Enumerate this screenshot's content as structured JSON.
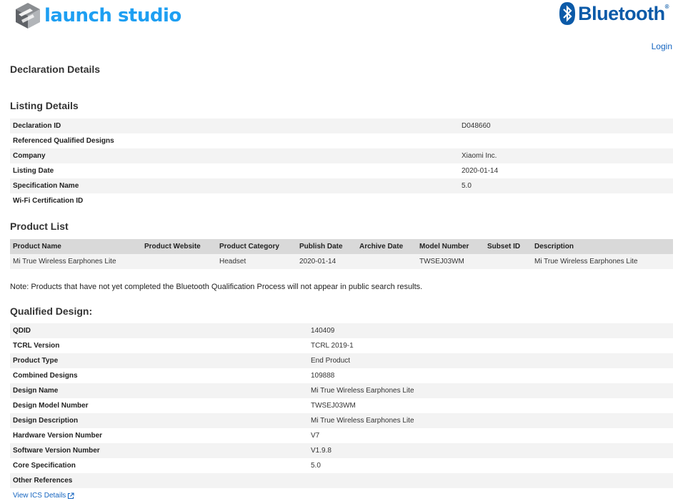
{
  "header": {
    "launch_text": "launch studio",
    "bluetooth_text": "Bluetooth",
    "bluetooth_reg": "®",
    "login": "Login"
  },
  "page_title": "Declaration Details",
  "listing": {
    "title": "Listing Details",
    "rows": [
      {
        "key": "Declaration ID",
        "value": "D048660"
      },
      {
        "key": "Referenced Qualified Designs",
        "value": ""
      },
      {
        "key": "Company",
        "value": "Xiaomi Inc."
      },
      {
        "key": "Listing Date",
        "value": "2020-01-14"
      },
      {
        "key": "Specification Name",
        "value": "5.0"
      },
      {
        "key": "Wi-Fi Certification ID",
        "value": ""
      }
    ]
  },
  "products": {
    "title": "Product List",
    "headers": [
      "Product Name",
      "Product Website",
      "Product Category",
      "Publish Date",
      "Archive Date",
      "Model Number",
      "Subset ID",
      "Description"
    ],
    "rows": [
      [
        "Mi True Wireless Earphones Lite",
        "",
        "Headset",
        "2020-01-14",
        "",
        "TWSEJ03WM",
        "",
        "Mi True Wireless Earphones Lite"
      ]
    ]
  },
  "note": "Note: Products that have not yet completed the Bluetooth Qualification Process will not appear in public search results.",
  "qualified": {
    "title": "Qualified Design:",
    "rows": [
      {
        "key": "QDID",
        "value": "140409"
      },
      {
        "key": "TCRL Version",
        "value": "TCRL 2019-1"
      },
      {
        "key": "Product Type",
        "value": "End Product"
      },
      {
        "key": "Combined Designs",
        "value": "109888"
      },
      {
        "key": "Design Name",
        "value": "Mi True Wireless Earphones Lite"
      },
      {
        "key": "Design Model Number",
        "value": "TWSEJ03WM"
      },
      {
        "key": "Design Description",
        "value": "Mi True Wireless Earphones Lite"
      },
      {
        "key": "Hardware Version Number",
        "value": "V7"
      },
      {
        "key": "Software Version Number",
        "value": "V1.9.8"
      },
      {
        "key": "Core Specification",
        "value": "5.0"
      },
      {
        "key": "Other References",
        "value": ""
      }
    ],
    "ics_link": "View ICS Details"
  },
  "colors": {
    "launch_blue": "#1e9ff2",
    "bluetooth_blue": "#0b5aa8",
    "link_blue": "#1565c0",
    "row_shade": "#f3f3f3",
    "header_shade": "#d9d9d9"
  }
}
